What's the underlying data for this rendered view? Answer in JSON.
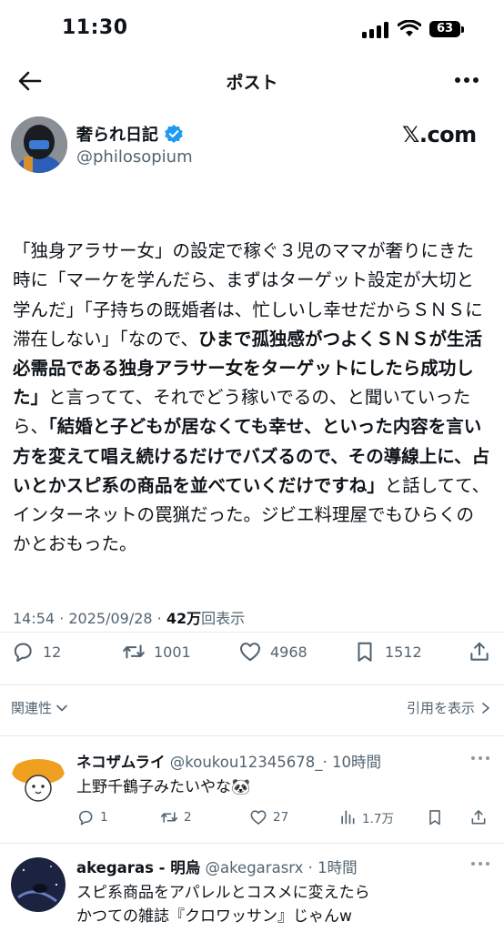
{
  "status_bar": {
    "time": "11:30",
    "battery": "63"
  },
  "nav": {
    "title": "ポスト"
  },
  "author": {
    "name": "奢られ日記",
    "handle": "@philosopium",
    "source": "𝕏.com"
  },
  "post": {
    "segments": [
      {
        "text": "「独身アラサー女」の設定で稼ぐ３児のママが奢りにきた時に「マーケを学んだら、まずはターゲット設定が大切と学んだ」「子持ちの既婚者は、忙しいし幸せだからＳＮＳに滞在しない」「なので、",
        "bold": false
      },
      {
        "text": "ひまで孤独感がつよくＳＮＳが生活必需品である独身アラサー女をターゲットにしたら成功した」",
        "bold": true
      },
      {
        "text": "と言ってて、それでどう稼いでるの、と聞いていったら、",
        "bold": false
      },
      {
        "text": "「結婚と子どもが居なくても幸せ、といった内容を言い方を変えて唱え続けるだけでバズるので、その導線上に、占いとかスピ系の商品を並べていくだけですね」",
        "bold": true
      },
      {
        "text": "と話してて、インターネットの罠猟だった。ジビエ料理屋でもひらくのかとおもった。",
        "bold": false
      }
    ],
    "timestamp": "14:54 · 2025/09/28 · ",
    "views_count": "42万",
    "views_label": "回表示",
    "replies": "12",
    "reposts": "1001",
    "likes": "4968",
    "bookmarks": "1512"
  },
  "related": {
    "left_label": "関連性",
    "right_label": "引用を表示"
  },
  "replies": [
    {
      "name": "ネコザムライ",
      "meta": " @koukou12345678_· 10時間",
      "text": "上野千鶴子みたいやな🐼",
      "replies": "1",
      "reposts": "2",
      "likes": "27",
      "views": "1.7万"
    },
    {
      "name": "akegaras - 明烏",
      "meta": " @akegarasrx · 1時間",
      "text": "スピ系商品をアパレルとコスメに変えたら\nかつての雑誌『クロワッサン』じゃんw"
    }
  ],
  "colors": {
    "verified": "#1d9bf0",
    "secondary_text": "#536471",
    "divider": "#e6e9ec"
  }
}
